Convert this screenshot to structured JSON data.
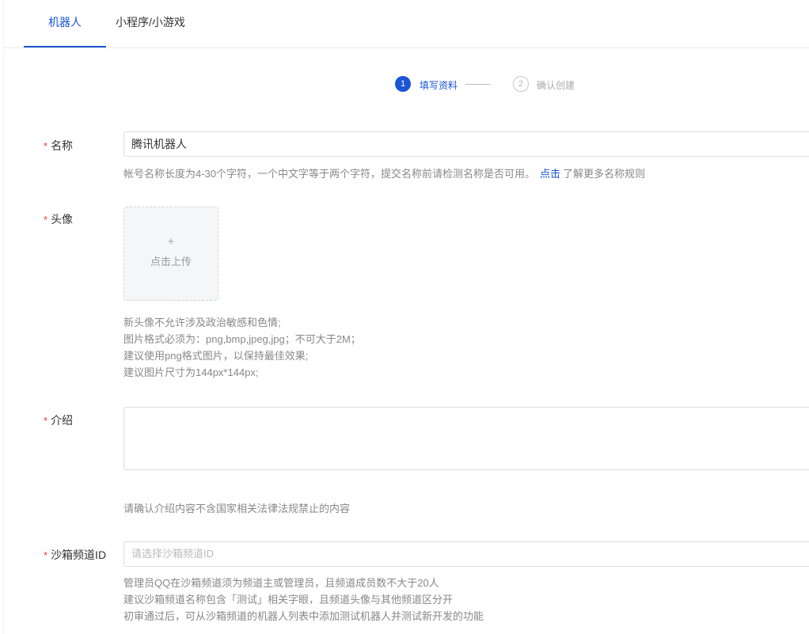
{
  "tabs": [
    {
      "label": "机器人",
      "active": true
    },
    {
      "label": "小程序/小游戏",
      "active": false
    }
  ],
  "steps": [
    {
      "number": "1",
      "label": "填写资料",
      "active": true
    },
    {
      "number": "2",
      "label": "确认创建",
      "active": false
    }
  ],
  "form": {
    "required_mark": "*",
    "name": {
      "label": "名称",
      "value": "腾讯机器人",
      "help_text": "帐号名称长度为4-30个字符，一个中文字等于两个字符，提交名称前请检测名称是否可用。",
      "help_link": "点击",
      "help_suffix": "了解更多名称规则"
    },
    "avatar": {
      "label": "头像",
      "upload_plus": "+",
      "upload_text": "点击上传",
      "help_lines": [
        "新头像不允许涉及政治敏感和色情;",
        "图片格式必须为：png,bmp,jpeg,jpg；不可大于2M；",
        "建议使用png格式图片，以保持最佳效果;",
        "建议图片尺寸为144px*144px;"
      ]
    },
    "intro": {
      "label": "介绍",
      "value": "",
      "help_text": "请确认介绍内容不含国家相关法律法规禁止的内容"
    },
    "sandbox": {
      "label": "沙箱频道ID",
      "placeholder": "请选择沙箱频道ID",
      "help_lines": [
        "管理员QQ在沙箱频道须为频道主或管理员，且频道成员数不大于20人",
        "建议沙箱频道名称包含「测试」相关字眼，且频道头像与其他频道区分开",
        "初审通过后，可从沙箱频道的机器人列表中添加测试机器人并测试新开发的功能"
      ]
    }
  },
  "colors": {
    "accent": "#1a55d6",
    "required": "#e53c3c"
  }
}
